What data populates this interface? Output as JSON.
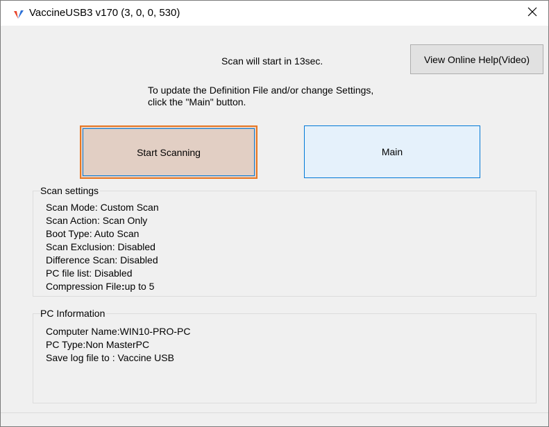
{
  "window": {
    "title": "VaccineUSB3 v170 (3, 0, 0, 530)",
    "icon": "vaccine-check-icon",
    "close_icon": "close-icon"
  },
  "status": {
    "countdown": "Scan will start in 13sec."
  },
  "help_button": {
    "label": "View Online Help(Video)"
  },
  "instructions": {
    "line1": "To update the Definition File and/or change Settings,",
    "line2": "click the  \"Main\" button."
  },
  "buttons": {
    "start_scanning": "Start Scanning",
    "main": "Main"
  },
  "scan_settings": {
    "title": "Scan settings",
    "items": [
      "Scan Mode: Custom Scan",
      "Scan Action: Scan Only",
      "Boot Type: Auto Scan",
      "Scan Exclusion: Disabled",
      "Difference Scan: Disabled",
      "PC file list: Disabled"
    ],
    "compression_label": "Compression File",
    "compression_colon": ":",
    "compression_value": "up to 5"
  },
  "pc_information": {
    "title": "PC Information",
    "items": [
      "Computer Name:WIN10-PRO-PC",
      "PC Type:Non MasterPC",
      "Save log file to : Vaccine USB"
    ]
  },
  "colors": {
    "accent_orange": "#e87722",
    "focus_blue": "#0078d7",
    "start_button_bg": "#e2cfc4",
    "main_button_bg": "#e5f1fb",
    "window_bg": "#f0f0f0"
  }
}
